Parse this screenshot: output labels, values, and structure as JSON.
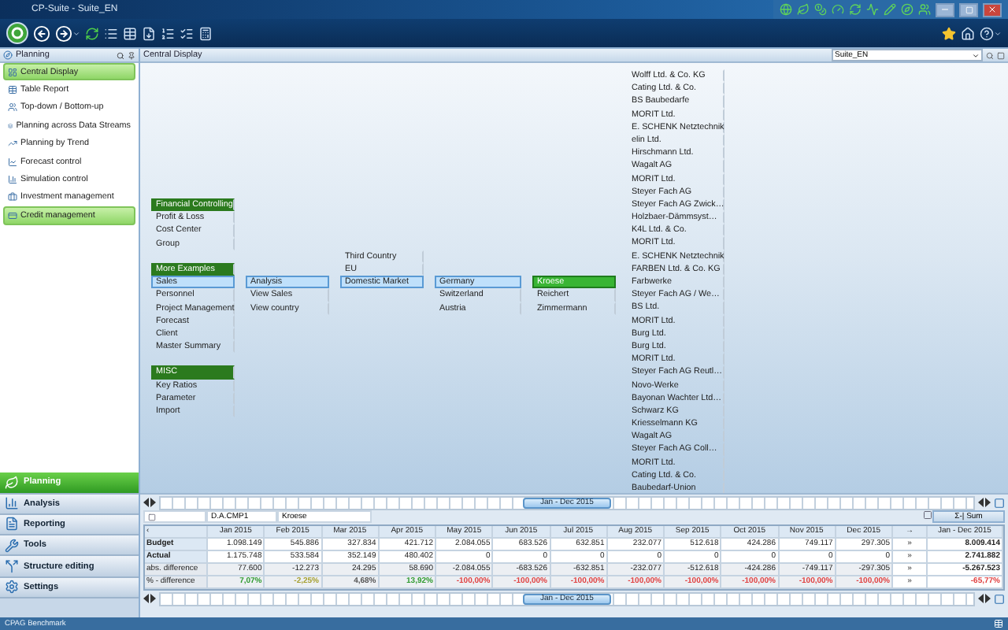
{
  "window": {
    "title": "CP-Suite - Suite_EN"
  },
  "sidebar": {
    "title": "Planning",
    "items": [
      {
        "label": "Central Display",
        "selected": true
      },
      {
        "label": "Table Report",
        "selected": false
      },
      {
        "label": "Top-down / Bottom-up",
        "selected": false
      },
      {
        "label": "Planning across Data Streams",
        "selected": false
      },
      {
        "label": "Planning by Trend",
        "selected": false
      },
      {
        "label": "Forecast control",
        "selected": false
      },
      {
        "label": "Simulation control",
        "selected": false
      },
      {
        "label": "Investment management",
        "selected": false
      },
      {
        "label": "Credit management",
        "selected": true
      }
    ]
  },
  "nav": [
    {
      "label": "Planning",
      "selected": true
    },
    {
      "label": "Analysis",
      "selected": false
    },
    {
      "label": "Reporting",
      "selected": false
    },
    {
      "label": "Tools",
      "selected": false
    },
    {
      "label": "Structure editing",
      "selected": false
    },
    {
      "label": "Settings",
      "selected": false
    }
  ],
  "view": {
    "title": "Central Display",
    "selector": "Suite_EN"
  },
  "tree": {
    "columns": [
      [
        {
          "label": "Financial Controlling",
          "kind": "header",
          "selected": false
        },
        {
          "label": "Profit & Loss",
          "kind": "item",
          "selected": false
        },
        {
          "label": "Cost Center",
          "kind": "item",
          "selected": false
        },
        {
          "label": "Group",
          "kind": "item",
          "selected": false
        },
        {
          "label": "More Examples",
          "kind": "header",
          "selected": false
        },
        {
          "label": "Sales",
          "kind": "item",
          "selected": true
        },
        {
          "label": "Personnel",
          "kind": "item",
          "selected": false
        },
        {
          "label": "Project Management",
          "kind": "item",
          "selected": false
        },
        {
          "label": "Forecast",
          "kind": "item",
          "selected": false
        },
        {
          "label": "Client",
          "kind": "item",
          "selected": false
        },
        {
          "label": "Master Summary",
          "kind": "item",
          "selected": false
        },
        {
          "label": "MISC",
          "kind": "header",
          "selected": false
        },
        {
          "label": "Key Ratios",
          "kind": "item",
          "selected": false
        },
        {
          "label": "Parameter",
          "kind": "item",
          "selected": false
        },
        {
          "label": "Import",
          "kind": "item",
          "selected": false
        }
      ],
      [
        {
          "label": "Analysis",
          "kind": "item",
          "selected": true
        },
        {
          "label": "View Sales",
          "kind": "item",
          "selected": false
        },
        {
          "label": "View country",
          "kind": "item",
          "selected": false
        }
      ],
      [
        {
          "label": "Third Country",
          "kind": "item",
          "selected": false
        },
        {
          "label": "EU",
          "kind": "item",
          "selected": false
        },
        {
          "label": "Domestic Market",
          "kind": "item",
          "selected": true
        }
      ],
      [
        {
          "label": "Germany",
          "kind": "item",
          "selected": true
        },
        {
          "label": "Switzerland",
          "kind": "item",
          "selected": false
        },
        {
          "label": "Austria",
          "kind": "item",
          "selected": false
        }
      ],
      [
        {
          "label": "Kroese",
          "kind": "current",
          "selected": true
        },
        {
          "label": "Reichert",
          "kind": "item",
          "selected": false
        },
        {
          "label": "Zimmermann",
          "kind": "item",
          "selected": false
        }
      ],
      [
        {
          "label": "Wolff Ltd. & Co. KG",
          "kind": "item",
          "selected": false
        },
        {
          "label": "Cating Ltd. & Co.",
          "kind": "item",
          "selected": false
        },
        {
          "label": "BS Baubedarfe",
          "kind": "item",
          "selected": false
        },
        {
          "label": "MORIT Ltd.",
          "kind": "item",
          "selected": false
        },
        {
          "label": "E. SCHENK Netztechnik",
          "kind": "item",
          "selected": false
        },
        {
          "label": "elin Ltd.",
          "kind": "item",
          "selected": false
        },
        {
          "label": "Hirschmann Ltd.",
          "kind": "item",
          "selected": false
        },
        {
          "label": "Wagalt AG",
          "kind": "item",
          "selected": false
        },
        {
          "label": "MORIT Ltd.",
          "kind": "item",
          "selected": false
        },
        {
          "label": "Steyer Fach AG",
          "kind": "item",
          "selected": false
        },
        {
          "label": "Steyer Fach AG Zwick…",
          "kind": "item",
          "selected": false
        },
        {
          "label": "Holzbaer-Dämmsyst…",
          "kind": "item",
          "selected": false
        },
        {
          "label": "K4L Ltd. & Co.",
          "kind": "item",
          "selected": false
        },
        {
          "label": "MORIT Ltd.",
          "kind": "item",
          "selected": false
        },
        {
          "label": "E. SCHENK Netztechnik",
          "kind": "item",
          "selected": false
        },
        {
          "label": "FARBEN Ltd. & Co. KG",
          "kind": "item",
          "selected": false
        },
        {
          "label": "Farbwerke",
          "kind": "item",
          "selected": false
        },
        {
          "label": "Steyer Fach AG / We…",
          "kind": "item",
          "selected": false
        },
        {
          "label": "BS Ltd.",
          "kind": "item",
          "selected": false
        },
        {
          "label": "MORIT Ltd.",
          "kind": "item",
          "selected": false
        },
        {
          "label": "Burg Ltd.",
          "kind": "item",
          "selected": false
        },
        {
          "label": "Burg Ltd.",
          "kind": "item",
          "selected": false
        },
        {
          "label": "MORIT Ltd.",
          "kind": "item",
          "selected": false
        },
        {
          "label": "Steyer Fach AG Reutl…",
          "kind": "item",
          "selected": false
        },
        {
          "label": "Novo-Werke",
          "kind": "item",
          "selected": false
        },
        {
          "label": "Bayonan Wachter Ltd…",
          "kind": "item",
          "selected": false
        },
        {
          "label": "Schwarz KG",
          "kind": "item",
          "selected": false
        },
        {
          "label": "Kriesselmann KG",
          "kind": "item",
          "selected": false
        },
        {
          "label": "Wagalt AG",
          "kind": "item",
          "selected": false
        },
        {
          "label": "Steyer Fach AG Coll…",
          "kind": "item",
          "selected": false
        },
        {
          "label": "MORIT Ltd.",
          "kind": "item",
          "selected": false
        },
        {
          "label": "Cating Ltd. & Co.",
          "kind": "item",
          "selected": false
        },
        {
          "label": "Baubedarf-Union",
          "kind": "item",
          "selected": false
        }
      ]
    ]
  },
  "timeline_top": {
    "label": "Jan - Dec 2015"
  },
  "filter": {
    "cells": [
      "D.A.CMP1",
      "Kroese"
    ],
    "sum_button": "Σ-| Sum"
  },
  "table": {
    "corner": "‹",
    "columns": [
      "Jan 2015",
      "Feb 2015",
      "Mar 2015",
      "Apr 2015",
      "May 2015",
      "Jun 2015",
      "Jul 2015",
      "Aug 2015",
      "Sep 2015",
      "Oct 2015",
      "Nov 2015",
      "Dec 2015"
    ],
    "arrow_header": "→",
    "total_header": "Jan - Dec 2015",
    "rows": [
      {
        "label": "Budget",
        "kind": "base",
        "values": [
          "1.098.149",
          "545.886",
          "327.834",
          "421.712",
          "2.084.055",
          "683.526",
          "632.851",
          "232.077",
          "512.618",
          "424.286",
          "749.117",
          "297.305"
        ],
        "arrow": "»",
        "total": "8.009.414"
      },
      {
        "label": "Actual",
        "kind": "base",
        "values": [
          "1.175.748",
          "533.584",
          "352.149",
          "480.402",
          "0",
          "0",
          "0",
          "0",
          "0",
          "0",
          "0",
          "0"
        ],
        "arrow": "»",
        "total": "2.741.882"
      },
      {
        "label": "abs. difference",
        "kind": "diff",
        "values": [
          "77.600",
          "-12.273",
          "24.295",
          "58.690",
          "-2.084.055",
          "-683.526",
          "-632.851",
          "-232.077",
          "-512.618",
          "-424.286",
          "-749.117",
          "-297.305"
        ],
        "arrow": "»",
        "total": "-5.267.523"
      },
      {
        "label": "% - difference",
        "kind": "diff",
        "values": [
          {
            "text": "7,07%",
            "color": "#2e9a2e"
          },
          {
            "text": "-2,25%",
            "color": "#a6a030"
          },
          {
            "text": "4,68%",
            "color": "#555555"
          },
          {
            "text": "13,92%",
            "color": "#2e9a2e"
          },
          {
            "text": "-100,00%",
            "color": "#e04040"
          },
          {
            "text": "-100,00%",
            "color": "#e04040"
          },
          {
            "text": "-100,00%",
            "color": "#e04040"
          },
          {
            "text": "-100,00%",
            "color": "#e04040"
          },
          {
            "text": "-100,00%",
            "color": "#e04040"
          },
          {
            "text": "-100,00%",
            "color": "#e04040"
          },
          {
            "text": "-100,00%",
            "color": "#e04040"
          },
          {
            "text": "-100,00%",
            "color": "#e04040"
          }
        ],
        "arrow": "»",
        "total": {
          "text": "-65,77%",
          "color": "#e04040"
        }
      }
    ]
  },
  "timeline_bottom": {
    "label": "Jan - Dec 2015"
  },
  "status_bar": {
    "text": "CPAG Benchmark"
  }
}
